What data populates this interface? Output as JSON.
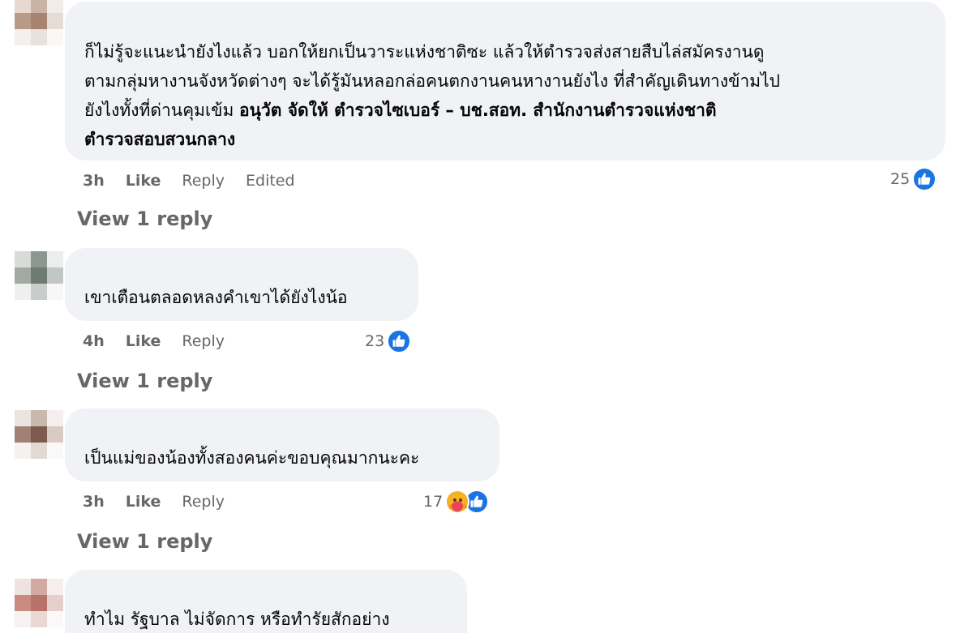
{
  "comments": [
    {
      "lines": [
        "ก็ไม่รู้จะแนะนำยังไงแล้ว บอกให้ยกเป็นวาระแห่งชาติซะ แล้วให้ตำรวจส่งสายสืบไล่สมัครงานดู",
        "ตามกลุ่มหางานจังหวัดต่างๆ จะได้รู้มันหลอกล่อคนตกงานคนหางานยังไง ที่สำคัญเดินทางข้ามไป",
        "ยังไงทั้งที่ด่านคุมเข้ม "
      ],
      "bold_line3": "อนุวัต จัดให้ ตำรวจไซเบอร์ – บช.สอท. สำนักงานตำรวจแห่งชาติ",
      "bold_line4": "ตำรวจสอบสวนกลาง",
      "time": "3h",
      "like": "Like",
      "reply": "Reply",
      "edited": "Edited",
      "reaction_count": "25",
      "reactions": [
        "like-icon"
      ],
      "view_reply": "View 1 reply"
    },
    {
      "text": "เขาเตือนตลอดหลงคำเขาได้ยังไงน้อ",
      "time": "4h",
      "like": "Like",
      "reply": "Reply",
      "reaction_count": "23",
      "reactions": [
        "like-icon"
      ],
      "view_reply": "View 1 reply"
    },
    {
      "text": "เป็นแม่ของน้องทั้งสองคนค่ะขอบคุณมากนะคะ",
      "time": "3h",
      "like": "Like",
      "reply": "Reply",
      "reaction_count": "17",
      "reactions": [
        "care-icon",
        "like-icon"
      ],
      "view_reply": "View 1 reply"
    },
    {
      "text": "ทำไม รัฐบาล ไม่จัดการ หรือทำรัยสักอย่าง"
    }
  ],
  "colors": {
    "bubble": "#f0f2f5",
    "meta_text": "#65676b",
    "body_text": "#050505",
    "like_blue": "#1b74e4",
    "care_yellow": "#f7b125"
  }
}
